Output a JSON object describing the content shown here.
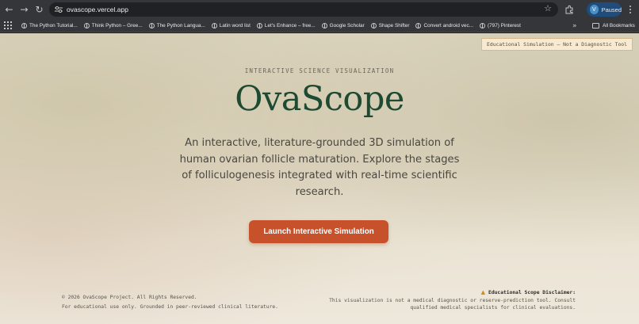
{
  "browser": {
    "url": "ovascope.vercel.app",
    "profile": {
      "initial": "V",
      "status": "Paused"
    },
    "bookmarks": [
      "The Python Tutorial...",
      "Think Python – Gree...",
      "The Python Langua...",
      "Latin word list",
      "Let's Enhance – free...",
      "Google Scholar",
      "Shape Shifter",
      "Convert android vec...",
      "(797) Pinterest"
    ],
    "more_glyph": "»",
    "all_bookmarks": "All Bookmarks"
  },
  "page": {
    "badge": "Educational Simulation — Not a Diagnostic Tool",
    "eyebrow": "INTERACTIVE SCIENCE VISUALIZATION",
    "brand": "OvaScope",
    "tagline": "An interactive, literature-grounded 3D simulation of human ovarian follicle maturation. Explore the stages of folliculogenesis integrated with real-time scientific research.",
    "cta": "Launch Interactive Simulation",
    "footer": {
      "copyright": "© 2026 OvaScope Project. All Rights Reserved.",
      "note": "For educational use only. Grounded in peer-reviewed clinical literature.",
      "disclaimer_title": "Educational Scope Disclaimer:",
      "disclaimer_text": "This visualization is not a medical diagnostic or reserve-prediction tool. Consult qualified medical specialists for clinical evaluations."
    }
  },
  "colors": {
    "brand": "#1d4a30",
    "cta": "#c7512b",
    "badge_bg": "#f6ead3",
    "warning": "#d08a18"
  },
  "icons": [
    "back-arrow-icon",
    "forward-arrow-icon",
    "reload-icon",
    "site-info-icon",
    "star-icon",
    "extensions-icon",
    "kebab-menu-icon",
    "apps-icon",
    "globe-icon",
    "folder-icon",
    "warning-icon"
  ]
}
